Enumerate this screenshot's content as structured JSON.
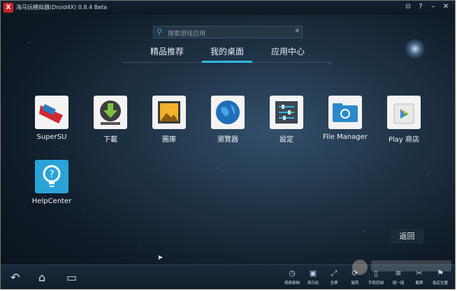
{
  "window": {
    "title": "海马玩模拟器(Droid4X) 0.8.4 Beta"
  },
  "titlebar_icons": [
    "target-icon",
    "help-icon",
    "minimize-icon",
    "close-icon"
  ],
  "search": {
    "placeholder": "搜索游戏应用"
  },
  "tabs": [
    {
      "label": "精品推荐",
      "active": false
    },
    {
      "label": "我的桌面",
      "active": true
    },
    {
      "label": "应用中心",
      "active": false
    }
  ],
  "apps": [
    {
      "label": "SuperSU",
      "icon": "supersu-icon"
    },
    {
      "label": "下載",
      "icon": "download-icon"
    },
    {
      "label": "圖庫",
      "icon": "gallery-icon"
    },
    {
      "label": "瀏覽器",
      "icon": "globe-icon"
    },
    {
      "label": "設定",
      "icon": "settings-icon"
    },
    {
      "label": "File Manager",
      "icon": "folder-icon"
    },
    {
      "label": "Play 商店",
      "icon": "play-store-icon"
    },
    {
      "label": "HelpCenter",
      "icon": "help-bulb-icon"
    }
  ],
  "back_button": {
    "label": "返回"
  },
  "toolbar": [
    {
      "label": "视频录制",
      "icon": "record-icon"
    },
    {
      "label": "海马玩",
      "icon": "haima-icon"
    },
    {
      "label": "全屏",
      "icon": "fullscreen-icon"
    },
    {
      "label": "旋转",
      "icon": "rotate-icon"
    },
    {
      "label": "手机控制",
      "icon": "phone-control-icon"
    },
    {
      "label": "摇一摇",
      "icon": "shake-icon"
    },
    {
      "label": "截屏",
      "icon": "screenshot-icon"
    },
    {
      "label": "指定位置",
      "icon": "location-icon"
    }
  ],
  "colors": {
    "accent": "#33b5e5",
    "background": "#1f3346"
  }
}
